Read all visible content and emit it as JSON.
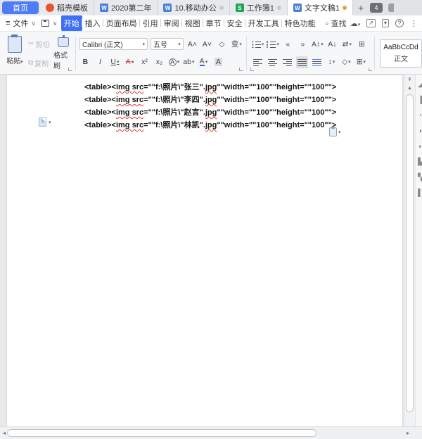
{
  "tabbar": {
    "home_label": "首页",
    "tabs": [
      {
        "label": "稻壳模板",
        "icon": "docer-icon",
        "icon_text": "",
        "dot": ""
      },
      {
        "label": "2020第二年",
        "icon": "writer-icon",
        "icon_text": "W",
        "dot": ""
      },
      {
        "label": "10.移动办公",
        "icon": "writer-icon",
        "icon_text": "W",
        "dot": "#c9c9c9"
      },
      {
        "label": "工作簿1",
        "icon": "sheet-icon",
        "icon_text": "S",
        "dot": "#c9c9c9"
      },
      {
        "label": "文字文稿1",
        "icon": "writer-icon",
        "icon_text": "W",
        "dot": "#e8a33d",
        "active": true
      }
    ],
    "new_tab_label": "+",
    "window_count_badge": "4"
  },
  "menubar": {
    "file_label": "文件",
    "items": [
      {
        "label": "开始",
        "active": true
      },
      {
        "label": "插入"
      },
      {
        "label": "页面布局"
      },
      {
        "label": "引用"
      },
      {
        "label": "审阅"
      },
      {
        "label": "视图"
      },
      {
        "label": "章节"
      },
      {
        "label": "安全"
      },
      {
        "label": "开发工具"
      },
      {
        "label": "特色功能"
      }
    ],
    "find_label": "查找"
  },
  "ribbon": {
    "paste_label": "粘贴",
    "cut_label": "剪切",
    "copy_label": "复制",
    "format_painter_label": "格式刷",
    "font_name": "Calibri (正文)",
    "font_size": "五号",
    "style_sample": "AaBbCcDd",
    "style_name": "正文"
  },
  "icons": {
    "hamburger": "≡",
    "chevron_down": "∨",
    "caret_down": "▾",
    "search": "🔍",
    "cloud": "☁",
    "share_arrow": "↗",
    "more_vertical": "⋮",
    "help": "?",
    "scissors": "✂",
    "copy_pages": "⿻",
    "grow_font": "A˄",
    "shrink_font": "A˅",
    "clear_format": "◇",
    "text_tool": "变",
    "bold": "B",
    "italic": "I",
    "underline": "U",
    "strikethrough": "A",
    "superscript": "x²",
    "subscript": "x₂",
    "text_effects": "A",
    "highlight": "ab",
    "font_color": "A",
    "char_shading": "A",
    "outdent": "«",
    "indent": "»",
    "text_direction": "A↕",
    "sort": "A↓",
    "marks": "⇄",
    "para_layout": "⊞",
    "line_spacing": "↕",
    "shading": "◇",
    "borders": "⊞",
    "scroll_up": "▲",
    "scroll_prev": "⇞",
    "scroll_left": "◂",
    "scroll_right": "▸"
  },
  "document": {
    "lines": [
      {
        "segments": [
          {
            "t": "<table><",
            "sq": false
          },
          {
            "t": "img src",
            "sq": true
          },
          {
            "t": "=\"\"f:\\照片\\\"张三\".",
            "sq": false
          },
          {
            "t": "jpg",
            "sq": true
          },
          {
            "t": "\"\"width=\"\"100\"\"height=\"\"100\"\">",
            "sq": false
          }
        ]
      },
      {
        "segments": [
          {
            "t": "<table><",
            "sq": false
          },
          {
            "t": "img src",
            "sq": true
          },
          {
            "t": "=\"\"f:\\照片\\\"李四\".",
            "sq": false
          },
          {
            "t": "jpg",
            "sq": true
          },
          {
            "t": "\"\"width=\"\"100\"\"height=\"\"100\"\">",
            "sq": false
          }
        ]
      },
      {
        "segments": [
          {
            "t": "<table><",
            "sq": false
          },
          {
            "t": "img src",
            "sq": true
          },
          {
            "t": "=\"\"f:\\照片\\\"赵言\".",
            "sq": false
          },
          {
            "t": "jpg",
            "sq": true
          },
          {
            "t": "\"\"width=\"\"100\"\"height=\"\"100\"\">",
            "sq": false
          }
        ]
      },
      {
        "segments": [
          {
            "t": "<table><",
            "sq": false
          },
          {
            "t": "img src",
            "sq": true
          },
          {
            "t": "=\"\"f:\\照片\\\"林凯\".",
            "sq": false
          },
          {
            "t": "jpg",
            "sq": true
          },
          {
            "t": "\"\"width=\"\"100\"\"height=\"\"100\"\">",
            "sq": false
          }
        ]
      }
    ]
  }
}
